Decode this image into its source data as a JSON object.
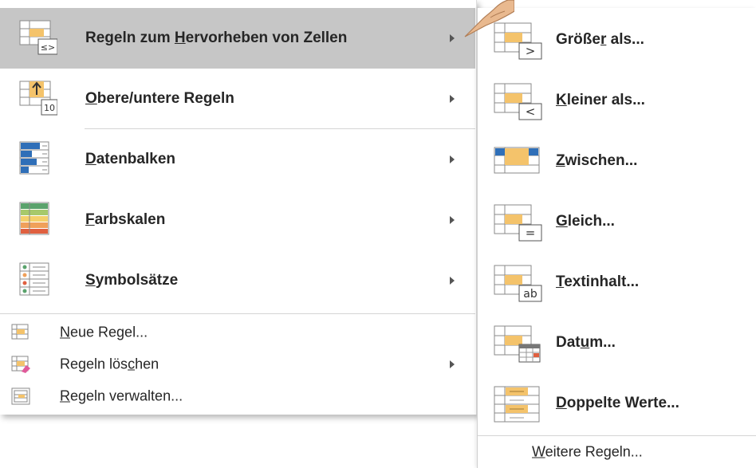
{
  "main_menu": {
    "items": [
      {
        "label_pre": "Regeln zum ",
        "mnemonic": "H",
        "label_post": "ervorheben von Zellen",
        "icon": "highlight-cells-icon",
        "has_submenu": true,
        "highlighted": true
      },
      {
        "label_pre": "",
        "mnemonic": "O",
        "label_post": "bere/untere Regeln",
        "icon": "top-bottom-rules-icon",
        "has_submenu": true
      },
      {
        "label_pre": "",
        "mnemonic": "D",
        "label_post": "atenbalken",
        "icon": "data-bars-icon",
        "has_submenu": true
      },
      {
        "label_pre": "",
        "mnemonic": "F",
        "label_post": "arbskalen",
        "icon": "color-scales-icon",
        "has_submenu": true
      },
      {
        "label_pre": "",
        "mnemonic": "S",
        "label_post": "ymbolsätze",
        "icon": "icon-sets-icon",
        "has_submenu": true
      }
    ],
    "small_items": [
      {
        "label_pre": "",
        "mnemonic": "N",
        "label_post": "eue Regel...",
        "icon": "new-rule-icon"
      },
      {
        "label_pre": "Regeln lös",
        "mnemonic": "c",
        "label_post": "hen",
        "icon": "clear-rules-icon",
        "has_submenu": true
      },
      {
        "label_pre": "",
        "mnemonic": "R",
        "label_post": "egeln verwalten...",
        "icon": "manage-rules-icon"
      }
    ]
  },
  "submenu": {
    "items": [
      {
        "label_pre": "Größe",
        "mnemonic": "r",
        "label_post": " als...",
        "icon": "greater-than-icon",
        "badge": ">"
      },
      {
        "label_pre": "",
        "mnemonic": "K",
        "label_post": "leiner als...",
        "icon": "less-than-icon",
        "badge": "<"
      },
      {
        "label_pre": "",
        "mnemonic": "Z",
        "label_post": "wischen...",
        "icon": "between-icon"
      },
      {
        "label_pre": "",
        "mnemonic": "G",
        "label_post": "leich...",
        "icon": "equal-to-icon",
        "badge": "="
      },
      {
        "label_pre": "",
        "mnemonic": "T",
        "label_post": "extinhalt...",
        "icon": "text-contains-icon",
        "badge": "ab"
      },
      {
        "label_pre": "Dat",
        "mnemonic": "u",
        "label_post": "m...",
        "icon": "date-occurring-icon"
      },
      {
        "label_pre": "",
        "mnemonic": "D",
        "label_post": "oppelte Werte...",
        "icon": "duplicate-values-icon"
      }
    ],
    "footer": {
      "label_pre": "",
      "mnemonic": "W",
      "label_post": "eitere Regeln..."
    }
  },
  "icon_badges": {
    "less_equal": "≤>",
    "ten": "10"
  },
  "colors": {
    "highlight_bg": "#c6c6c6",
    "accent_yellow": "#f4c36b",
    "accent_blue": "#2f6fb8",
    "grid_line": "#8a8a8a"
  }
}
